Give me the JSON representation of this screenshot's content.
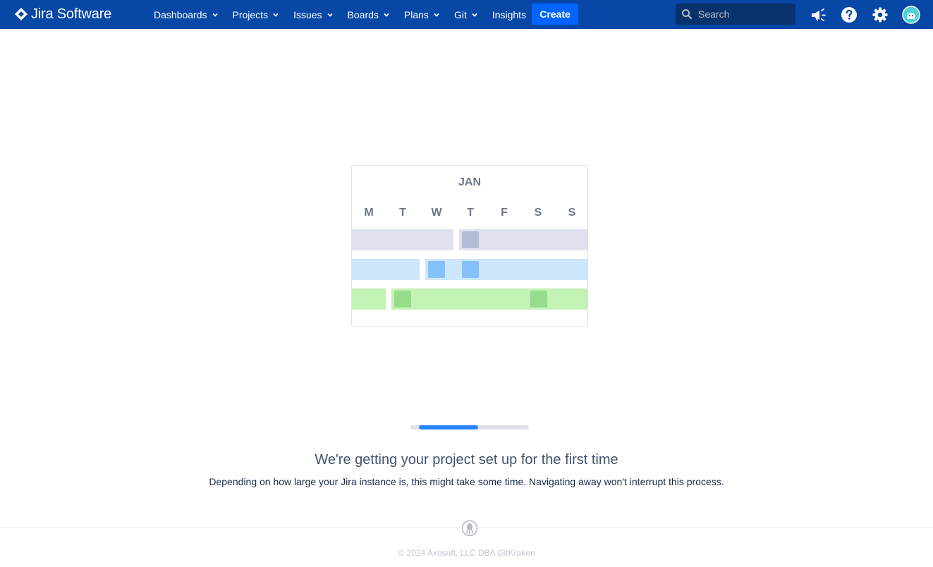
{
  "app": {
    "name": "Jira Software",
    "logo_icon": "jira-diamond-icon"
  },
  "nav": {
    "items": [
      {
        "label": "Dashboards",
        "has_dropdown": true
      },
      {
        "label": "Projects",
        "has_dropdown": true
      },
      {
        "label": "Issues",
        "has_dropdown": true
      },
      {
        "label": "Boards",
        "has_dropdown": true
      },
      {
        "label": "Plans",
        "has_dropdown": true
      },
      {
        "label": "Git",
        "has_dropdown": true
      },
      {
        "label": "Insights",
        "has_dropdown": false
      }
    ],
    "create_label": "Create",
    "search_placeholder": "Search",
    "right_icons": [
      "megaphone-icon",
      "help-icon",
      "settings-icon",
      "avatar"
    ]
  },
  "calendar": {
    "month": "JAN",
    "days": [
      "M",
      "T",
      "W",
      "T",
      "F",
      "S",
      "S"
    ]
  },
  "progress": {
    "fraction": 0.5
  },
  "message": {
    "title": "We're getting your project set up for the first time",
    "subtitle": "Depending on how large your Jira instance is, this might take some time. Navigating away won't interrupt this process."
  },
  "footer": {
    "text": "© 2024 Axosoft, LLC DBA GitKraken",
    "logo_icon": "gitkraken-icon"
  },
  "colors": {
    "topbar": "#0747a6",
    "create": "#0065ff",
    "progress": "#2684ff"
  }
}
